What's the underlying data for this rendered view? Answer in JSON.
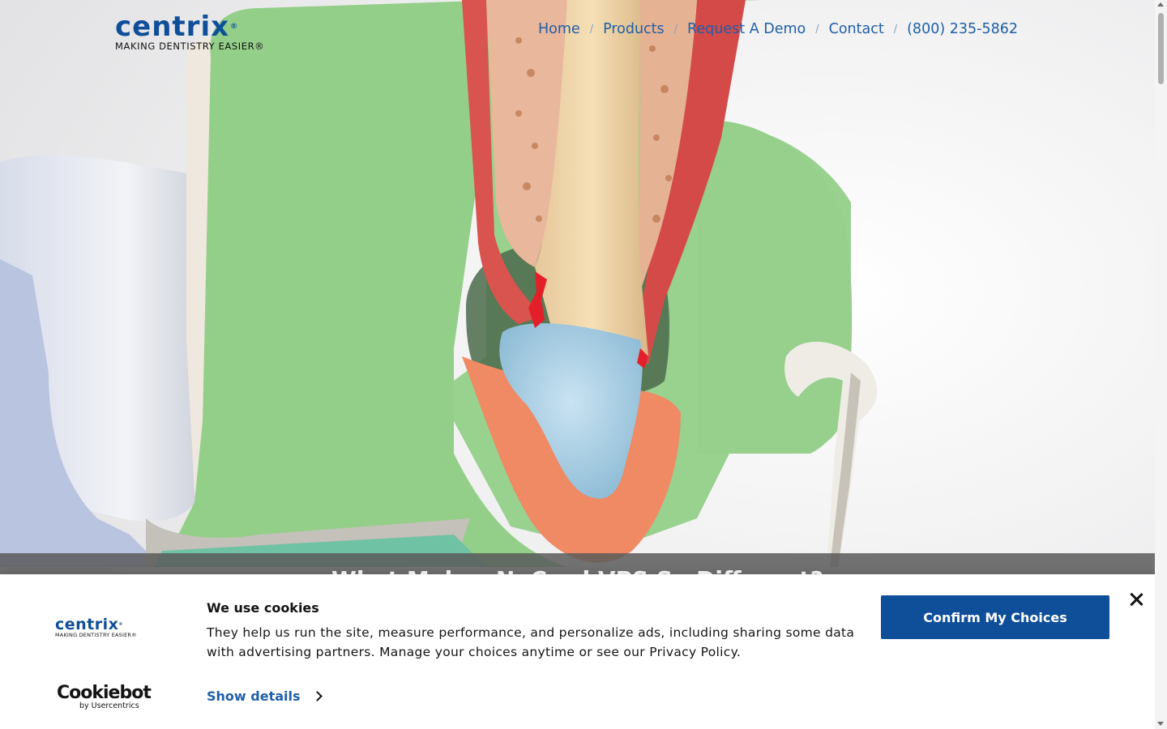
{
  "brand": {
    "name": "centrix",
    "trademark": "®",
    "tagline": "MAKING DENTISTRY EASIER",
    "tagline_trademark": "®",
    "primary_color": "#0f4f9a",
    "link_color": "#1f5fa8"
  },
  "nav": {
    "items": [
      {
        "label": "Home"
      },
      {
        "label": "Products"
      },
      {
        "label": "Request A Demo"
      },
      {
        "label": "Contact"
      },
      {
        "label": "(800) 235-5862"
      }
    ],
    "separator": "/"
  },
  "hero": {
    "illustration": "tooth-root-cross-section-illustration",
    "caption": "What Makes NoCord VPS So Different?"
  },
  "cookie_banner": {
    "title": "We use cookies",
    "text": "They help us run the site, measure performance, and personalize ads, including sharing some data with advertising partners. Manage your choices anytime or see our Privacy Policy.",
    "details_label": "Show details",
    "confirm_label": "Confirm My Choices",
    "close_icon": "close-icon",
    "provider_name": "Cookiebot",
    "provider_by": "by Usercentrics"
  }
}
